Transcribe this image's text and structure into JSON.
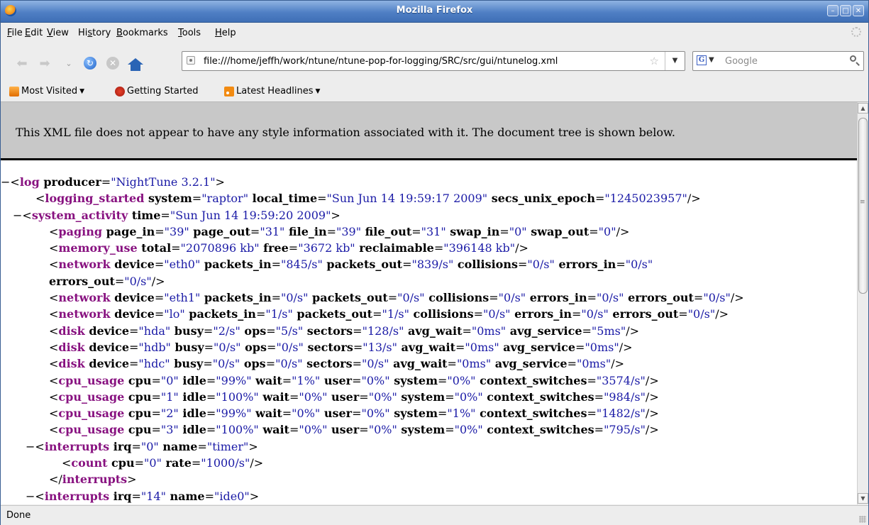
{
  "window": {
    "title": "Mozilla Firefox",
    "min_icon": "minimize-icon",
    "max_icon": "maximize-icon",
    "close_icon": "close-icon"
  },
  "menubar": {
    "items": [
      {
        "pre": "",
        "u": "F",
        "post": "ile"
      },
      {
        "pre": "",
        "u": "E",
        "post": "dit"
      },
      {
        "pre": "",
        "u": "V",
        "post": "iew"
      },
      {
        "pre": "Hi",
        "u": "s",
        "post": "tory"
      },
      {
        "pre": "",
        "u": "B",
        "post": "ookmarks"
      },
      {
        "pre": "",
        "u": "T",
        "post": "ools"
      },
      {
        "pre": "",
        "u": "H",
        "post": "elp"
      }
    ]
  },
  "navbar": {
    "url": "file:///home/jeffh/work/ntune/ntune-pop-for-logging/SRC/src/gui/ntunelog.xml",
    "search_placeholder": "Google",
    "engine_letter": "G"
  },
  "bookmarks": {
    "items": [
      {
        "label": "Most Visited",
        "icon": "most-visited-icon",
        "dropdown": true
      },
      {
        "label": "Getting Started",
        "icon": "getting-started-icon",
        "dropdown": false
      },
      {
        "label": "Latest Headlines",
        "icon": "rss-icon",
        "dropdown": true
      }
    ]
  },
  "notice": "This XML file does not appear to have any style information associated with it. The document tree is shown below.",
  "xml_lines": [
    {
      "collapse": "−",
      "indent": 16,
      "parts": [
        [
          "p",
          "<"
        ],
        [
          "t",
          "log"
        ],
        [
          "a",
          " producer"
        ],
        [
          "p",
          "="
        ],
        [
          "v",
          "\"NightTune 3.2.1\""
        ],
        [
          "p",
          ">"
        ]
      ]
    },
    {
      "collapse": "",
      "indent": 49,
      "parts": [
        [
          "p",
          "<"
        ],
        [
          "t",
          "logging_started"
        ],
        [
          "a",
          " system"
        ],
        [
          "p",
          "="
        ],
        [
          "v",
          "\"raptor\""
        ],
        [
          "a",
          " local_time"
        ],
        [
          "p",
          "="
        ],
        [
          "v",
          "\"Sun Jun 14 19:59:17 2009\""
        ],
        [
          "a",
          " secs_unix_epoch"
        ],
        [
          "p",
          "="
        ],
        [
          "v",
          "\"1245023957\""
        ],
        [
          "p",
          "/>"
        ]
      ]
    },
    {
      "collapse": "−",
      "indent": 33,
      "parts": [
        [
          "p",
          "<"
        ],
        [
          "t",
          "system_activity"
        ],
        [
          "a",
          " time"
        ],
        [
          "p",
          "="
        ],
        [
          "v",
          "\"Sun Jun 14 19:59:20 2009\""
        ],
        [
          "p",
          ">"
        ]
      ]
    },
    {
      "collapse": "",
      "indent": 68,
      "parts": [
        [
          "p",
          "<"
        ],
        [
          "t",
          "paging"
        ],
        [
          "a",
          " page_in"
        ],
        [
          "p",
          "="
        ],
        [
          "v",
          "\"39\""
        ],
        [
          "a",
          " page_out"
        ],
        [
          "p",
          "="
        ],
        [
          "v",
          "\"31\""
        ],
        [
          "a",
          " file_in"
        ],
        [
          "p",
          "="
        ],
        [
          "v",
          "\"39\""
        ],
        [
          "a",
          " file_out"
        ],
        [
          "p",
          "="
        ],
        [
          "v",
          "\"31\""
        ],
        [
          "a",
          " swap_in"
        ],
        [
          "p",
          "="
        ],
        [
          "v",
          "\"0\""
        ],
        [
          "a",
          " swap_out"
        ],
        [
          "p",
          "="
        ],
        [
          "v",
          "\"0\""
        ],
        [
          "p",
          "/>"
        ]
      ]
    },
    {
      "collapse": "",
      "indent": 68,
      "parts": [
        [
          "p",
          "<"
        ],
        [
          "t",
          "memory_use"
        ],
        [
          "a",
          " total"
        ],
        [
          "p",
          "="
        ],
        [
          "v",
          "\"2070896 kb\""
        ],
        [
          "a",
          " free"
        ],
        [
          "p",
          "="
        ],
        [
          "v",
          "\"3672 kb\""
        ],
        [
          "a",
          " reclaimable"
        ],
        [
          "p",
          "="
        ],
        [
          "v",
          "\"396148 kb\""
        ],
        [
          "p",
          "/>"
        ]
      ]
    },
    {
      "collapse": "",
      "indent": 68,
      "parts": [
        [
          "p",
          "<"
        ],
        [
          "t",
          "network"
        ],
        [
          "a",
          " device"
        ],
        [
          "p",
          "="
        ],
        [
          "v",
          "\"eth0\""
        ],
        [
          "a",
          " packets_in"
        ],
        [
          "p",
          "="
        ],
        [
          "v",
          "\"845/s\""
        ],
        [
          "a",
          " packets_out"
        ],
        [
          "p",
          "="
        ],
        [
          "v",
          "\"839/s\""
        ],
        [
          "a",
          " collisions"
        ],
        [
          "p",
          "="
        ],
        [
          "v",
          "\"0/s\""
        ],
        [
          "a",
          " errors_in"
        ],
        [
          "p",
          "="
        ],
        [
          "v",
          "\"0/s\""
        ]
      ]
    },
    {
      "collapse": "",
      "indent": 68,
      "parts": [
        [
          "a",
          "errors_out"
        ],
        [
          "p",
          "="
        ],
        [
          "v",
          "\"0/s\""
        ],
        [
          "p",
          "/>"
        ]
      ]
    },
    {
      "collapse": "",
      "indent": 68,
      "parts": [
        [
          "p",
          "<"
        ],
        [
          "t",
          "network"
        ],
        [
          "a",
          " device"
        ],
        [
          "p",
          "="
        ],
        [
          "v",
          "\"eth1\""
        ],
        [
          "a",
          " packets_in"
        ],
        [
          "p",
          "="
        ],
        [
          "v",
          "\"0/s\""
        ],
        [
          "a",
          " packets_out"
        ],
        [
          "p",
          "="
        ],
        [
          "v",
          "\"0/s\""
        ],
        [
          "a",
          " collisions"
        ],
        [
          "p",
          "="
        ],
        [
          "v",
          "\"0/s\""
        ],
        [
          "a",
          " errors_in"
        ],
        [
          "p",
          "="
        ],
        [
          "v",
          "\"0/s\""
        ],
        [
          "a",
          " errors_out"
        ],
        [
          "p",
          "="
        ],
        [
          "v",
          "\"0/s\""
        ],
        [
          "p",
          "/>"
        ]
      ]
    },
    {
      "collapse": "",
      "indent": 68,
      "parts": [
        [
          "p",
          "<"
        ],
        [
          "t",
          "network"
        ],
        [
          "a",
          " device"
        ],
        [
          "p",
          "="
        ],
        [
          "v",
          "\"lo\""
        ],
        [
          "a",
          " packets_in"
        ],
        [
          "p",
          "="
        ],
        [
          "v",
          "\"1/s\""
        ],
        [
          "a",
          " packets_out"
        ],
        [
          "p",
          "="
        ],
        [
          "v",
          "\"1/s\""
        ],
        [
          "a",
          " collisions"
        ],
        [
          "p",
          "="
        ],
        [
          "v",
          "\"0/s\""
        ],
        [
          "a",
          " errors_in"
        ],
        [
          "p",
          "="
        ],
        [
          "v",
          "\"0/s\""
        ],
        [
          "a",
          " errors_out"
        ],
        [
          "p",
          "="
        ],
        [
          "v",
          "\"0/s\""
        ],
        [
          "p",
          "/>"
        ]
      ]
    },
    {
      "collapse": "",
      "indent": 68,
      "parts": [
        [
          "p",
          "<"
        ],
        [
          "t",
          "disk"
        ],
        [
          "a",
          " device"
        ],
        [
          "p",
          "="
        ],
        [
          "v",
          "\"hda\""
        ],
        [
          "a",
          " busy"
        ],
        [
          "p",
          "="
        ],
        [
          "v",
          "\"2/s\""
        ],
        [
          "a",
          " ops"
        ],
        [
          "p",
          "="
        ],
        [
          "v",
          "\"5/s\""
        ],
        [
          "a",
          " sectors"
        ],
        [
          "p",
          "="
        ],
        [
          "v",
          "\"128/s\""
        ],
        [
          "a",
          " avg_wait"
        ],
        [
          "p",
          "="
        ],
        [
          "v",
          "\"0ms\""
        ],
        [
          "a",
          " avg_service"
        ],
        [
          "p",
          "="
        ],
        [
          "v",
          "\"5ms\""
        ],
        [
          "p",
          "/>"
        ]
      ]
    },
    {
      "collapse": "",
      "indent": 68,
      "parts": [
        [
          "p",
          "<"
        ],
        [
          "t",
          "disk"
        ],
        [
          "a",
          " device"
        ],
        [
          "p",
          "="
        ],
        [
          "v",
          "\"hdb\""
        ],
        [
          "a",
          " busy"
        ],
        [
          "p",
          "="
        ],
        [
          "v",
          "\"0/s\""
        ],
        [
          "a",
          " ops"
        ],
        [
          "p",
          "="
        ],
        [
          "v",
          "\"0/s\""
        ],
        [
          "a",
          " sectors"
        ],
        [
          "p",
          "="
        ],
        [
          "v",
          "\"13/s\""
        ],
        [
          "a",
          " avg_wait"
        ],
        [
          "p",
          "="
        ],
        [
          "v",
          "\"0ms\""
        ],
        [
          "a",
          " avg_service"
        ],
        [
          "p",
          "="
        ],
        [
          "v",
          "\"0ms\""
        ],
        [
          "p",
          "/>"
        ]
      ]
    },
    {
      "collapse": "",
      "indent": 68,
      "parts": [
        [
          "p",
          "<"
        ],
        [
          "t",
          "disk"
        ],
        [
          "a",
          " device"
        ],
        [
          "p",
          "="
        ],
        [
          "v",
          "\"hdc\""
        ],
        [
          "a",
          " busy"
        ],
        [
          "p",
          "="
        ],
        [
          "v",
          "\"0/s\""
        ],
        [
          "a",
          " ops"
        ],
        [
          "p",
          "="
        ],
        [
          "v",
          "\"0/s\""
        ],
        [
          "a",
          " sectors"
        ],
        [
          "p",
          "="
        ],
        [
          "v",
          "\"0/s\""
        ],
        [
          "a",
          " avg_wait"
        ],
        [
          "p",
          "="
        ],
        [
          "v",
          "\"0ms\""
        ],
        [
          "a",
          " avg_service"
        ],
        [
          "p",
          "="
        ],
        [
          "v",
          "\"0ms\""
        ],
        [
          "p",
          "/>"
        ]
      ]
    },
    {
      "collapse": "",
      "indent": 68,
      "parts": [
        [
          "p",
          "<"
        ],
        [
          "t",
          "cpu_usage"
        ],
        [
          "a",
          " cpu"
        ],
        [
          "p",
          "="
        ],
        [
          "v",
          "\"0\""
        ],
        [
          "a",
          " idle"
        ],
        [
          "p",
          "="
        ],
        [
          "v",
          "\"99%\""
        ],
        [
          "a",
          " wait"
        ],
        [
          "p",
          "="
        ],
        [
          "v",
          "\"1%\""
        ],
        [
          "a",
          " user"
        ],
        [
          "p",
          "="
        ],
        [
          "v",
          "\"0%\""
        ],
        [
          "a",
          " system"
        ],
        [
          "p",
          "="
        ],
        [
          "v",
          "\"0%\""
        ],
        [
          "a",
          " context_switches"
        ],
        [
          "p",
          "="
        ],
        [
          "v",
          "\"3574/s\""
        ],
        [
          "p",
          "/>"
        ]
      ]
    },
    {
      "collapse": "",
      "indent": 68,
      "parts": [
        [
          "p",
          "<"
        ],
        [
          "t",
          "cpu_usage"
        ],
        [
          "a",
          " cpu"
        ],
        [
          "p",
          "="
        ],
        [
          "v",
          "\"1\""
        ],
        [
          "a",
          " idle"
        ],
        [
          "p",
          "="
        ],
        [
          "v",
          "\"100%\""
        ],
        [
          "a",
          " wait"
        ],
        [
          "p",
          "="
        ],
        [
          "v",
          "\"0%\""
        ],
        [
          "a",
          " user"
        ],
        [
          "p",
          "="
        ],
        [
          "v",
          "\"0%\""
        ],
        [
          "a",
          " system"
        ],
        [
          "p",
          "="
        ],
        [
          "v",
          "\"0%\""
        ],
        [
          "a",
          " context_switches"
        ],
        [
          "p",
          "="
        ],
        [
          "v",
          "\"984/s\""
        ],
        [
          "p",
          "/>"
        ]
      ]
    },
    {
      "collapse": "",
      "indent": 68,
      "parts": [
        [
          "p",
          "<"
        ],
        [
          "t",
          "cpu_usage"
        ],
        [
          "a",
          " cpu"
        ],
        [
          "p",
          "="
        ],
        [
          "v",
          "\"2\""
        ],
        [
          "a",
          " idle"
        ],
        [
          "p",
          "="
        ],
        [
          "v",
          "\"99%\""
        ],
        [
          "a",
          " wait"
        ],
        [
          "p",
          "="
        ],
        [
          "v",
          "\"0%\""
        ],
        [
          "a",
          " user"
        ],
        [
          "p",
          "="
        ],
        [
          "v",
          "\"0%\""
        ],
        [
          "a",
          " system"
        ],
        [
          "p",
          "="
        ],
        [
          "v",
          "\"1%\""
        ],
        [
          "a",
          " context_switches"
        ],
        [
          "p",
          "="
        ],
        [
          "v",
          "\"1482/s\""
        ],
        [
          "p",
          "/>"
        ]
      ]
    },
    {
      "collapse": "",
      "indent": 68,
      "parts": [
        [
          "p",
          "<"
        ],
        [
          "t",
          "cpu_usage"
        ],
        [
          "a",
          " cpu"
        ],
        [
          "p",
          "="
        ],
        [
          "v",
          "\"3\""
        ],
        [
          "a",
          " idle"
        ],
        [
          "p",
          "="
        ],
        [
          "v",
          "\"100%\""
        ],
        [
          "a",
          " wait"
        ],
        [
          "p",
          "="
        ],
        [
          "v",
          "\"0%\""
        ],
        [
          "a",
          " user"
        ],
        [
          "p",
          "="
        ],
        [
          "v",
          "\"0%\""
        ],
        [
          "a",
          " system"
        ],
        [
          "p",
          "="
        ],
        [
          "v",
          "\"0%\""
        ],
        [
          "a",
          " context_switches"
        ],
        [
          "p",
          "="
        ],
        [
          "v",
          "\"795/s\""
        ],
        [
          "p",
          "/>"
        ]
      ]
    },
    {
      "collapse": "−",
      "indent": 51,
      "parts": [
        [
          "p",
          "<"
        ],
        [
          "t",
          "interrupts"
        ],
        [
          "a",
          " irq"
        ],
        [
          "p",
          "="
        ],
        [
          "v",
          "\"0\""
        ],
        [
          "a",
          " name"
        ],
        [
          "p",
          "="
        ],
        [
          "v",
          "\"timer\""
        ],
        [
          "p",
          ">"
        ]
      ]
    },
    {
      "collapse": "",
      "indent": 86,
      "parts": [
        [
          "p",
          "<"
        ],
        [
          "t",
          "count"
        ],
        [
          "a",
          " cpu"
        ],
        [
          "p",
          "="
        ],
        [
          "v",
          "\"0\""
        ],
        [
          "a",
          " rate"
        ],
        [
          "p",
          "="
        ],
        [
          "v",
          "\"1000/s\""
        ],
        [
          "p",
          "/>"
        ]
      ]
    },
    {
      "collapse": "",
      "indent": 68,
      "parts": [
        [
          "p",
          "</"
        ],
        [
          "t",
          "interrupts"
        ],
        [
          "p",
          ">"
        ]
      ]
    },
    {
      "collapse": "−",
      "indent": 51,
      "parts": [
        [
          "p",
          "<"
        ],
        [
          "t",
          "interrupts"
        ],
        [
          "a",
          " irq"
        ],
        [
          "p",
          "="
        ],
        [
          "v",
          "\"14\""
        ],
        [
          "a",
          " name"
        ],
        [
          "p",
          "="
        ],
        [
          "v",
          "\"ide0\""
        ],
        [
          "p",
          ">"
        ]
      ]
    }
  ],
  "status": "Done",
  "colors": {
    "tag": "#881280",
    "value": "#1a1aa6",
    "notice_bg": "#c8c8c8",
    "titlebar": "#4f7fc4"
  }
}
